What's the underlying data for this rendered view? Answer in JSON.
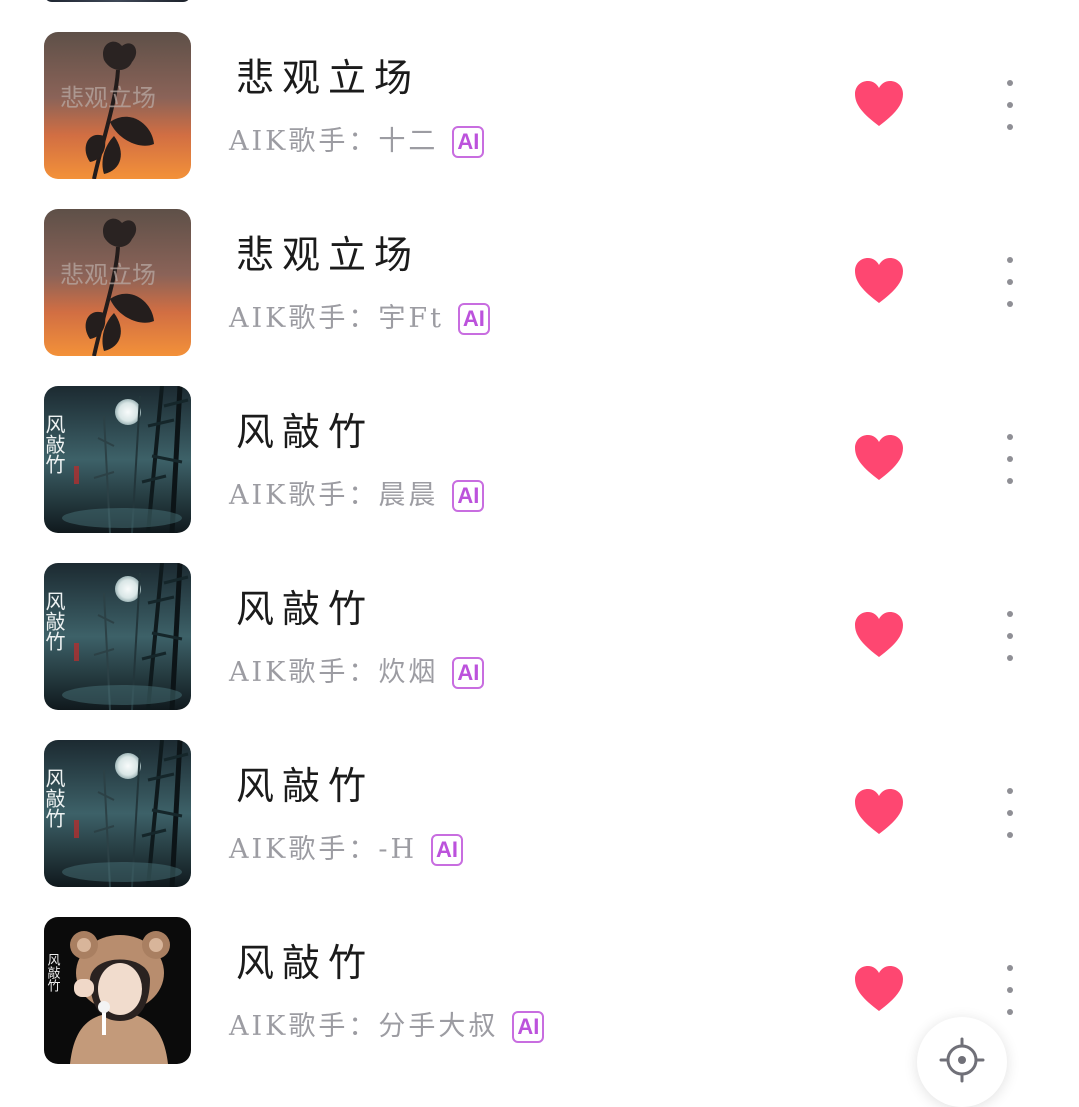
{
  "songs": [
    {
      "title": "悲观立场",
      "artist": "AIK歌手：十二",
      "badge": "AI",
      "cover": "rose-silhouette-sunset-art",
      "cover_text": "悲观立场"
    },
    {
      "title": "悲观立场",
      "artist": "AIK歌手：宇Ft",
      "badge": "AI",
      "cover": "rose-silhouette-sunset-art",
      "cover_text": "悲观立场"
    },
    {
      "title": "风敲竹",
      "artist": "AIK歌手：晨晨",
      "badge": "AI",
      "cover": "bamboo-moonlight-art",
      "cover_text": "风敲竹"
    },
    {
      "title": "风敲竹",
      "artist": "AIK歌手：炊烟",
      "badge": "AI",
      "cover": "bamboo-moonlight-art",
      "cover_text": "风敲竹"
    },
    {
      "title": "风敲竹",
      "artist": "AIK歌手：-H",
      "badge": "AI",
      "cover": "bamboo-moonlight-art",
      "cover_text": "风敲竹"
    },
    {
      "title": "风敲竹",
      "artist": "AIK歌手：分手大叔",
      "badge": "AI",
      "cover": "girl-bear-hood-photo",
      "cover_text": "风敲竹"
    }
  ],
  "icons": {
    "favorite": "heart-icon",
    "more": "more-vertical-icon",
    "locate": "locate-icon"
  },
  "colors": {
    "favorite": "#fe4771",
    "badge": "#c054de",
    "title": "#1b1b1b",
    "subtitle": "#9c9ca2"
  }
}
